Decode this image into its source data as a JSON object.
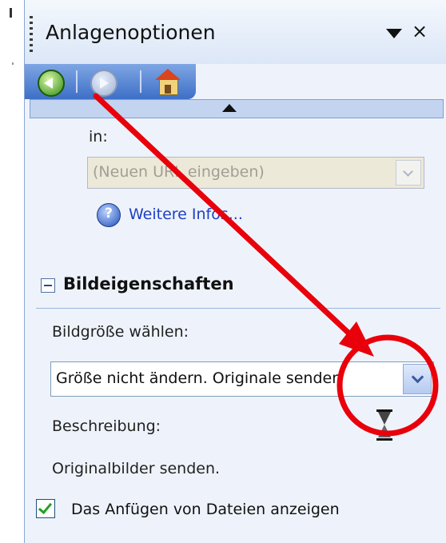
{
  "pane": {
    "title": "Anlagenoptionen",
    "menu_icon": "triangle-down-icon",
    "close_label": "×"
  },
  "nav": {
    "back_icon": "back-arrow-icon",
    "forward_icon": "forward-arrow-icon",
    "home_icon": "home-icon"
  },
  "link_section": {
    "in_label": "in:",
    "url_placeholder": "(Neuen URL eingeben)",
    "help_link": "Weitere Infos..."
  },
  "image_properties": {
    "title": "Bildeigenschaften",
    "size_label": "Bildgröße wählen:",
    "size_selected": "Größe nicht ändern. Originale senden",
    "description_label": "Beschreibung:",
    "description_value": "Originalbilder senden.",
    "show_attachments_label": "Das Anfügen von Dateien anzeigen",
    "show_attachments_checked": true
  },
  "annotation": {
    "color": "#e8000b"
  }
}
